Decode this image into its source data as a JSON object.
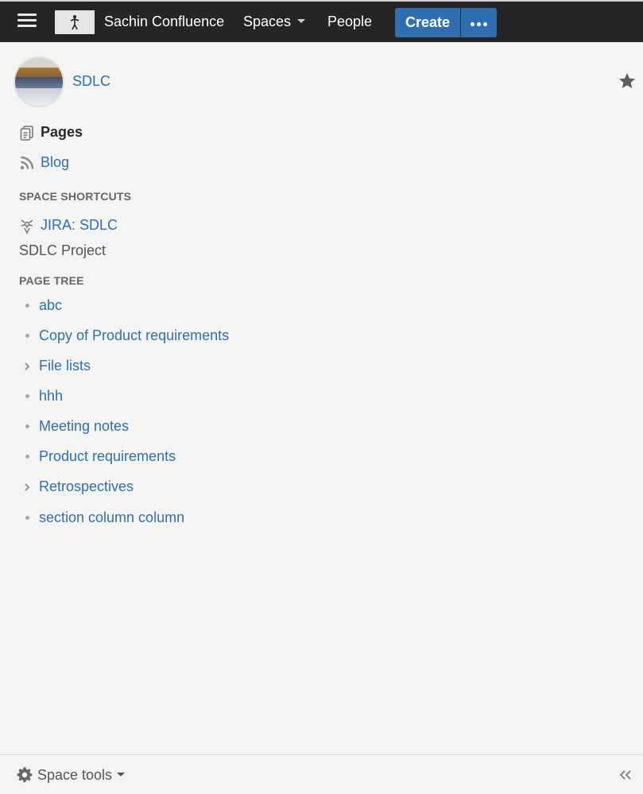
{
  "header": {
    "site_title": "Sachin Confluence",
    "spaces_label": "Spaces",
    "people_label": "People",
    "create_label": "Create",
    "menu_icon": "hamburger-menu-icon",
    "more_icon": "more-dots-icon",
    "logo_icon": "person-logo-icon"
  },
  "space": {
    "name": "SDLC",
    "star_icon": "star-icon"
  },
  "nav": {
    "pages_label": "Pages",
    "blog_label": "Blog"
  },
  "shortcuts": {
    "heading": "SPACE SHORTCUTS",
    "jira_label": "JIRA: SDLC",
    "project_label": "SDLC Project"
  },
  "page_tree": {
    "heading": "PAGE TREE",
    "items": [
      {
        "label": "abc",
        "marker": "bullet"
      },
      {
        "label": "Copy of Product requirements",
        "marker": "bullet"
      },
      {
        "label": "File lists",
        "marker": "chevron"
      },
      {
        "label": "hhh",
        "marker": "bullet"
      },
      {
        "label": "Meeting notes",
        "marker": "bullet"
      },
      {
        "label": "Product requirements",
        "marker": "bullet"
      },
      {
        "label": "Retrospectives",
        "marker": "chevron"
      },
      {
        "label": "section column column",
        "marker": "bullet"
      }
    ]
  },
  "footer": {
    "space_tools_label": "Space tools",
    "collapse_icon": "double-chevron-left-icon"
  },
  "colors": {
    "topbar_bg": "#252525",
    "accent_blue": "#2f6fb0",
    "page_bg": "#f4f4f4"
  }
}
